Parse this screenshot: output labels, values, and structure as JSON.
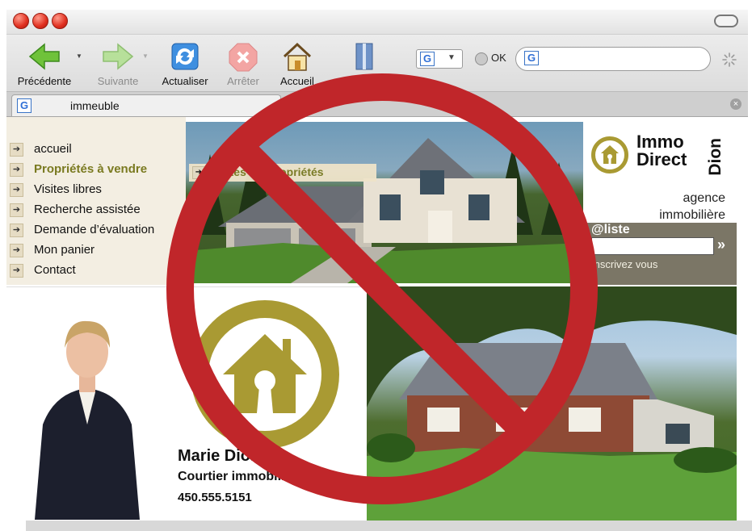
{
  "toolbar": {
    "back_label": "Précédente",
    "forward_label": "Suivante",
    "reload_label": "Actualiser",
    "stop_label": "Arrêter",
    "home_label": "Accueil",
    "bookmarks_label": "Signets",
    "search_engine_glyph": "G",
    "ok_label": "OK"
  },
  "tab": {
    "title": "immeuble"
  },
  "nav": {
    "items": [
      {
        "label": "accueil"
      },
      {
        "label": "Propriétés à vendre"
      },
      {
        "label": "Visites libres"
      },
      {
        "label": "Recherche assistée"
      },
      {
        "label": "Demande d’évaluation"
      },
      {
        "label": "Mon panier"
      },
      {
        "label": "Contact"
      }
    ],
    "submenu_label": "Toutes les propriétés"
  },
  "brand": {
    "line1": "Immo",
    "line2": "Direct",
    "vertical": "Dion",
    "tagline1": "agence",
    "tagline2": "immobilière"
  },
  "liste": {
    "title": "@liste",
    "go_label": "»",
    "subtitle": "Inscrivez vous"
  },
  "agent": {
    "name": "Marie Dion",
    "role": "Courtier immobilier",
    "phone": "450.555.5151"
  },
  "colors": {
    "brand_olive": "#a99a33",
    "forbidden_red": "#c0262a",
    "panel_taupe": "#7b7666"
  }
}
